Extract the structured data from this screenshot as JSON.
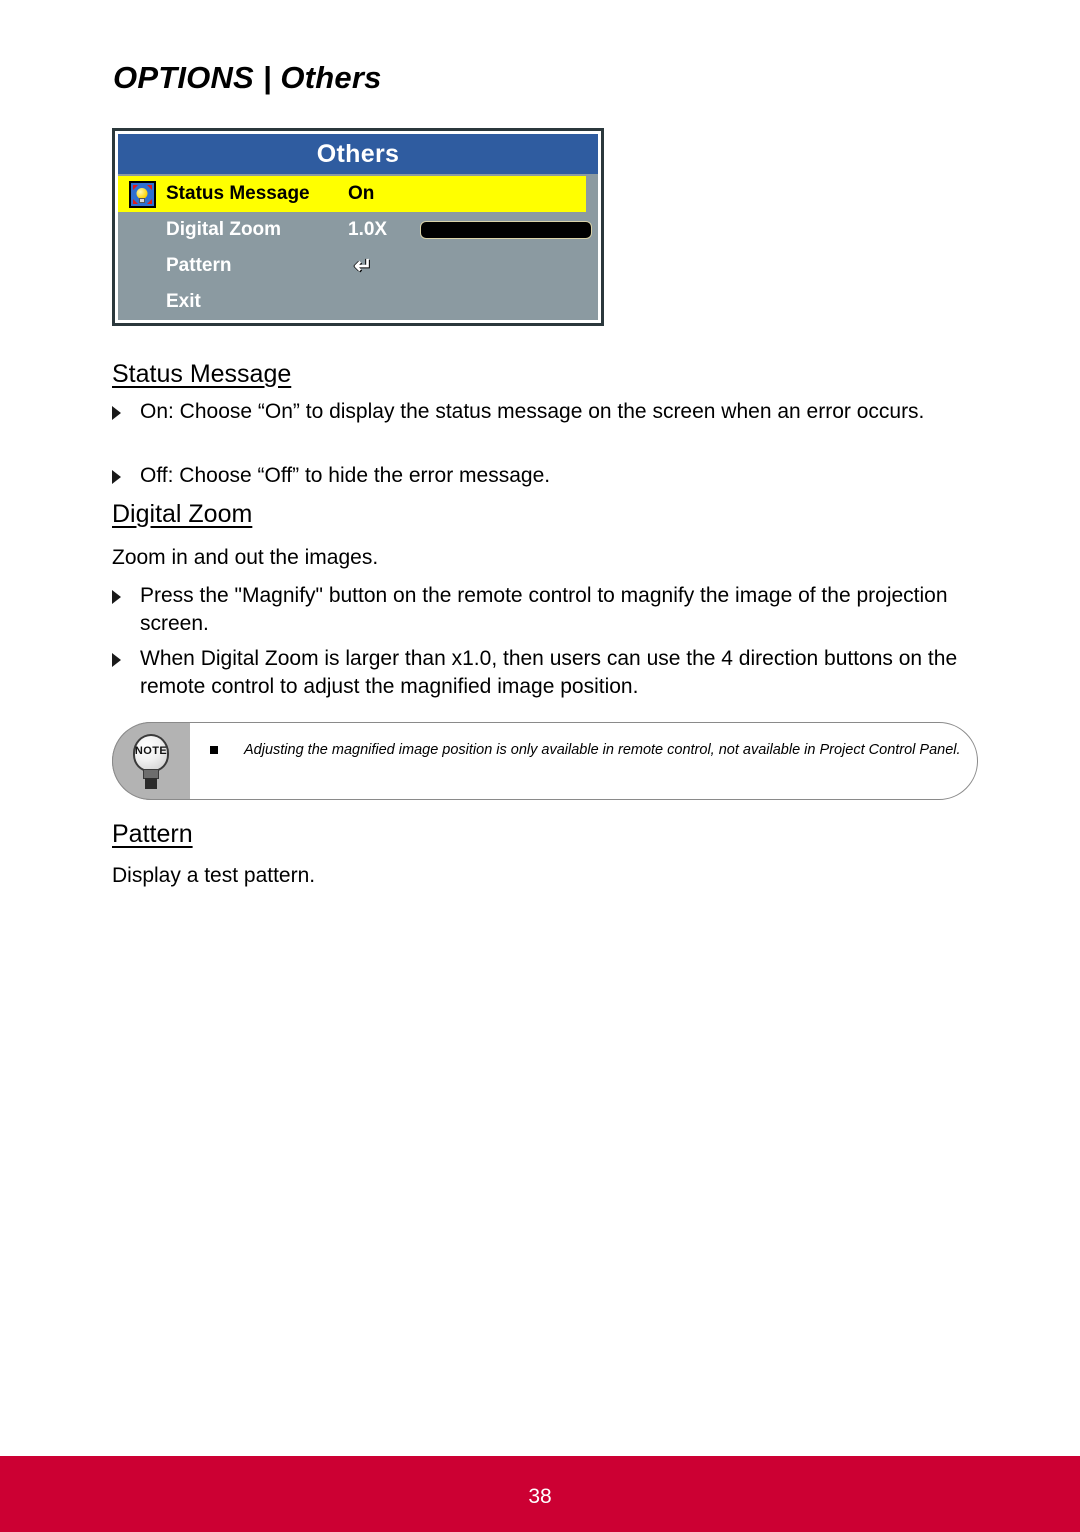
{
  "header": {
    "title": "OPTIONS | Others"
  },
  "osd": {
    "title": "Others",
    "rows": [
      {
        "label": "Status Message",
        "value": "On",
        "icon": "lightbulb-icon",
        "selected": true,
        "control": "text"
      },
      {
        "label": "Digital Zoom",
        "value": "1.0X",
        "icon": "",
        "selected": false,
        "control": "slider"
      },
      {
        "label": "Pattern",
        "value": "↵",
        "icon": "",
        "selected": false,
        "control": "enter"
      },
      {
        "label": "Exit",
        "value": "",
        "icon": "",
        "selected": false,
        "control": "none"
      }
    ]
  },
  "sections": [
    {
      "heading": "Status Message",
      "bullets": [
        "On: Choose “On” to display the status message on the screen when an error occurs.",
        "Off: Choose “Off” to hide the error message."
      ]
    },
    {
      "heading": "Digital Zoom",
      "intro": "Zoom in and out the images.",
      "bullets": [
        "Press the \"Magnify\" button on the remote control to magnify the image of the projection screen.",
        "When Digital Zoom is larger than x1.0, then users can use the 4 direction buttons on the remote control to adjust the magnified image position."
      ]
    },
    {
      "heading": "Pattern",
      "intro": "Display a test pattern."
    }
  ],
  "note": {
    "badge_label": "NOTE",
    "text": "Adjusting the magnified image position is only available in remote control, not available in Project Control Panel."
  },
  "footer": {
    "page_number": "38",
    "bar_color": "#cc0033"
  }
}
